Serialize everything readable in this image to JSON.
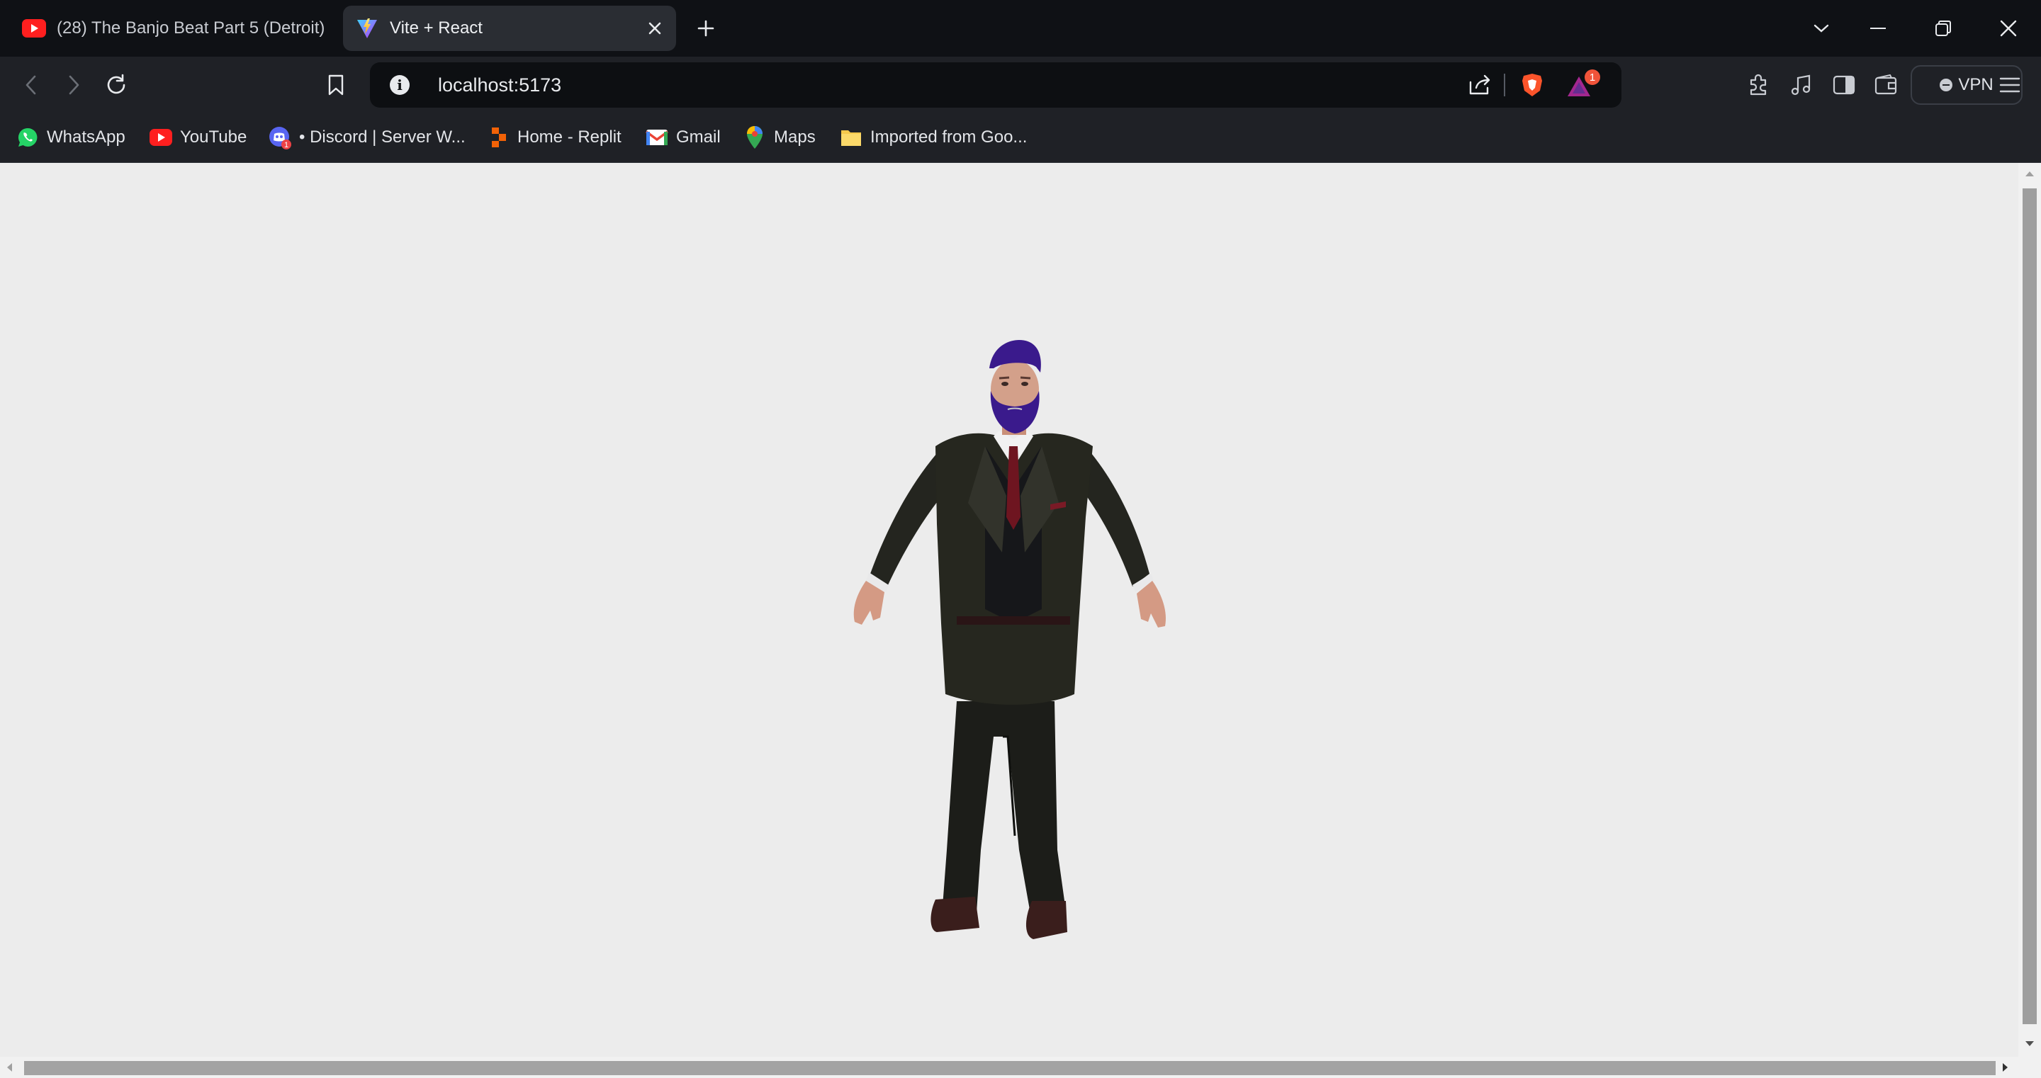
{
  "tabs": [
    {
      "title": "(28) The Banjo Beat Part 5 (Detroit)",
      "icon": "youtube-icon",
      "active": false
    },
    {
      "title": "Vite + React",
      "icon": "vite-icon",
      "active": true
    }
  ],
  "toolbar": {
    "url": "localhost:5173",
    "vpn_label": "VPN",
    "brave_rewards_badge": "1"
  },
  "bookmarks": [
    {
      "label": "WhatsApp",
      "icon": "whatsapp-icon"
    },
    {
      "label": "YouTube",
      "icon": "youtube-icon"
    },
    {
      "label": "• Discord | Server W...",
      "icon": "discord-icon"
    },
    {
      "label": "Home - Replit",
      "icon": "replit-icon"
    },
    {
      "label": "Gmail",
      "icon": "gmail-icon"
    },
    {
      "label": "Maps",
      "icon": "maps-icon"
    },
    {
      "label": "Imported from Goo...",
      "icon": "folder-icon"
    }
  ],
  "colors": {
    "tabstrip_bg": "#0f1115",
    "toolbar_bg": "#1f2126",
    "page_bg": "#ececec",
    "beard_hair": "#3a1a8c",
    "suit": "#22231e",
    "tie": "#6e1520"
  }
}
